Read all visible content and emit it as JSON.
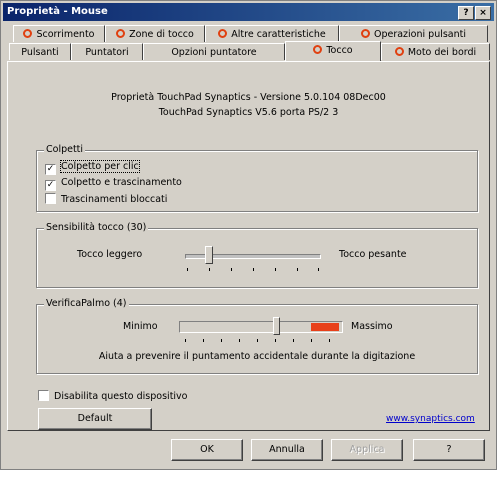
{
  "window": {
    "title": "Proprietà - Mouse",
    "help_btn": "?",
    "close_btn": "×"
  },
  "tabs_row1": [
    {
      "label": "Scorrimento",
      "icon": "synaptics-icon"
    },
    {
      "label": "Zone di tocco",
      "icon": "synaptics-icon"
    },
    {
      "label": "Altre caratteristiche",
      "icon": "synaptics-icon"
    },
    {
      "label": "Operazioni pulsanti",
      "icon": "synaptics-icon"
    }
  ],
  "tabs_row2": [
    {
      "label": "Pulsanti"
    },
    {
      "label": "Puntatori"
    },
    {
      "label": "Opzioni puntatore"
    },
    {
      "label": "Tocco",
      "icon": "synaptics-icon",
      "active": true
    },
    {
      "label": "Moto dei bordi",
      "icon": "synaptics-icon"
    }
  ],
  "info": {
    "line1": "Proprietà TouchPad Synaptics - Versione 5.0.104 08Dec00",
    "line2": "TouchPad Synaptics V5.6 porta PS/2 3"
  },
  "colpetti": {
    "label": "Colpetti",
    "options": [
      {
        "label": "Colpetto per clic",
        "checked": true
      },
      {
        "label": "Colpetto e trascinamento",
        "checked": true
      },
      {
        "label": "Trascinamenti bloccati",
        "checked": false
      }
    ]
  },
  "sensitivity": {
    "label": "Sensibilità tocco (30)",
    "left_label": "Tocco leggero",
    "right_label": "Tocco pesante",
    "value": 30
  },
  "verificapalmo": {
    "label": "VerificaPalmo (4)",
    "min_label": "Minimo",
    "max_label": "Massimo",
    "description": "Aiuta a prevenire il puntamento accidentale durante la digitazione",
    "value": 4,
    "indicator_color": "#e8401a"
  },
  "disable_device": {
    "label": "Disabilita questo dispositivo",
    "checked": false
  },
  "default_button": "Default",
  "link": "www.synaptics.com",
  "footer": {
    "ok": "OK",
    "cancel": "Annulla",
    "apply": "Applica",
    "help": "?"
  }
}
